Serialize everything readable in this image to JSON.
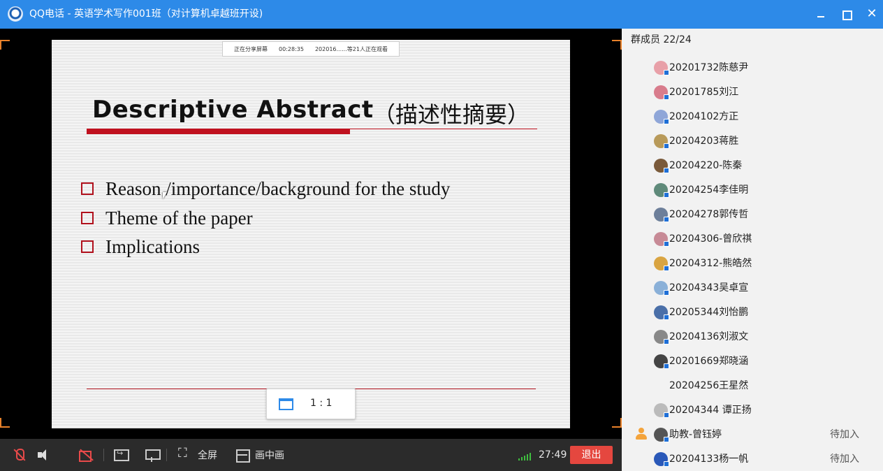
{
  "window": {
    "title": "QQ电话 - 英语学术写作001班（对计算机卓越班开设)",
    "icon": "qq-call-app-icon",
    "controls": [
      "minimize-icon",
      "maximize-icon",
      "close-icon"
    ],
    "close_glyph": "✕"
  },
  "share_bar": {
    "status": "正在分享屏幕",
    "elapsed": "00:28:35",
    "viewers": "202016......等21人正在观看"
  },
  "slide": {
    "title": "Descriptive Abstract",
    "title_cn": "（描述性摘要）",
    "bullets": [
      "Reason /importance/background for the study",
      "Theme of the paper",
      "Implications"
    ],
    "accent_color": "#c0111f"
  },
  "ratio_popup": {
    "label": "1 : 1"
  },
  "toolbar": {
    "fullscreen_label": "全屏",
    "pip_label": "画中画",
    "call_time": "27:49",
    "exit_label": "退出",
    "exit_color": "#e5473f"
  },
  "panel": {
    "title": "群成员 22/24",
    "members": [
      {
        "name": "20201732陈慈尹",
        "status": "",
        "avatar_color": "#e8a0a8"
      },
      {
        "name": "20201785刘江",
        "status": "",
        "avatar_color": "#d87c8c"
      },
      {
        "name": "20204102方正",
        "status": "",
        "avatar_color": "#8fa6d8"
      },
      {
        "name": "20204203蒋胜",
        "status": "",
        "avatar_color": "#b89a5a"
      },
      {
        "name": "20204220-陈秦",
        "status": "",
        "avatar_color": "#7a5a3a"
      },
      {
        "name": "20204254李佳明",
        "status": "",
        "avatar_color": "#5f8a7a"
      },
      {
        "name": "20204278郭传哲",
        "status": "",
        "avatar_color": "#6d7f9a"
      },
      {
        "name": "20204306-曾欣祺",
        "status": "",
        "avatar_color": "#c78a96"
      },
      {
        "name": "20204312-熊皓然",
        "status": "",
        "avatar_color": "#d9a441"
      },
      {
        "name": "20204343吴卓宣",
        "status": "",
        "avatar_color": "#8ab0d8"
      },
      {
        "name": "20205344刘怡鹏",
        "status": "",
        "avatar_color": "#4a6fa8"
      },
      {
        "name": "20204136刘淑文",
        "status": "",
        "avatar_color": "#888888"
      },
      {
        "name": "20201669郑晓涵",
        "status": "",
        "avatar_color": "#444444"
      },
      {
        "name": "20204256王星然",
        "status": "",
        "avatar_color": ""
      },
      {
        "name": "20204344 谭正扬",
        "status": "",
        "avatar_color": "#bbbbbb"
      },
      {
        "name": "助教-曾钰婷",
        "status": "待加入",
        "avatar_color": "#555555"
      },
      {
        "name": "20204133杨一帆",
        "status": "待加入",
        "avatar_color": "#2a58b8"
      }
    ]
  },
  "icons": {
    "mic": "mic-muted-icon",
    "speaker": "speaker-icon",
    "camera": "camera-off-icon",
    "share": "share-screen-icon",
    "present": "presentation-icon",
    "fullscreen": "fullscreen-icon",
    "pip": "picture-in-picture-icon",
    "signal": "signal-strength-icon",
    "helper": "teaching-assistant-icon"
  }
}
